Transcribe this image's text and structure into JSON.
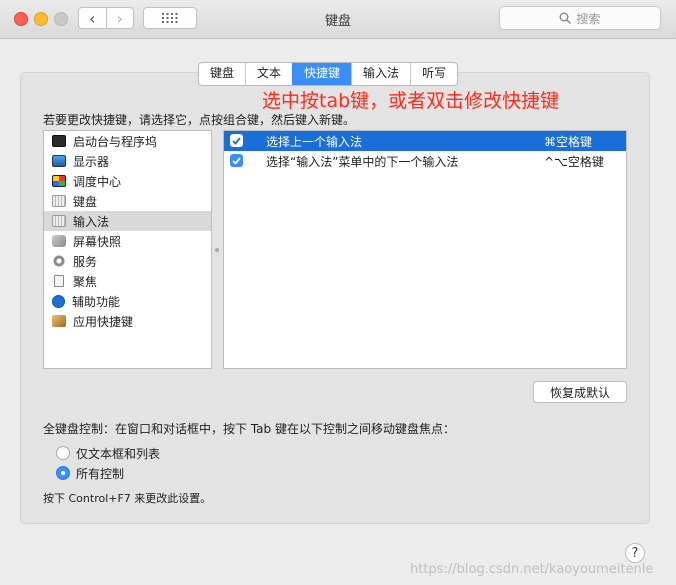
{
  "window": {
    "title": "键盘",
    "search_placeholder": "搜索"
  },
  "tabs": [
    {
      "label": "键盘",
      "active": false
    },
    {
      "label": "文本",
      "active": false
    },
    {
      "label": "快捷键",
      "active": true
    },
    {
      "label": "输入法",
      "active": false
    },
    {
      "label": "听写",
      "active": false
    }
  ],
  "annotation": "选中按tab键，或者双击修改快捷键",
  "instruction": "若要更改快捷键，请选择它，点按组合键，然后键入新键。",
  "categories": [
    {
      "label": "启动台与程序坞",
      "icon": "launchpad-dock-icon"
    },
    {
      "label": "显示器",
      "icon": "display-icon"
    },
    {
      "label": "调度中心",
      "icon": "mission-control-icon"
    },
    {
      "label": "键盘",
      "icon": "keyboard-icon"
    },
    {
      "label": "输入法",
      "icon": "input-source-icon",
      "selected": true
    },
    {
      "label": "屏幕快照",
      "icon": "screenshot-icon"
    },
    {
      "label": "服务",
      "icon": "services-gear-icon"
    },
    {
      "label": "聚焦",
      "icon": "spotlight-icon"
    },
    {
      "label": "辅助功能",
      "icon": "accessibility-icon"
    },
    {
      "label": "应用快捷键",
      "icon": "app-shortcuts-icon"
    }
  ],
  "shortcuts": [
    {
      "label": "选择上一个输入法",
      "key": "⌘空格键",
      "checked": true,
      "selected": true
    },
    {
      "label": "选择“输入法”菜单中的下一个输入法",
      "key": "^⌥空格键",
      "checked": true,
      "selected": false
    }
  ],
  "restore_button": "恢复成默认",
  "keyboard_control": {
    "label": "全键盘控制：在窗口和对话框中，按下 Tab 键在以下控制之间移动键盘焦点：",
    "options": [
      {
        "label": "仅文本框和列表",
        "selected": false
      },
      {
        "label": "所有控制",
        "selected": true
      }
    ]
  },
  "footnote": "按下 Control+F7 来更改此设置。",
  "help_label": "?",
  "watermark": "https://blog.csdn.net/kaoyoumeitenle",
  "colors": {
    "accent": "#3a8ef5",
    "selection": "#1a6ed8",
    "annotation": "#ff2a1a"
  }
}
